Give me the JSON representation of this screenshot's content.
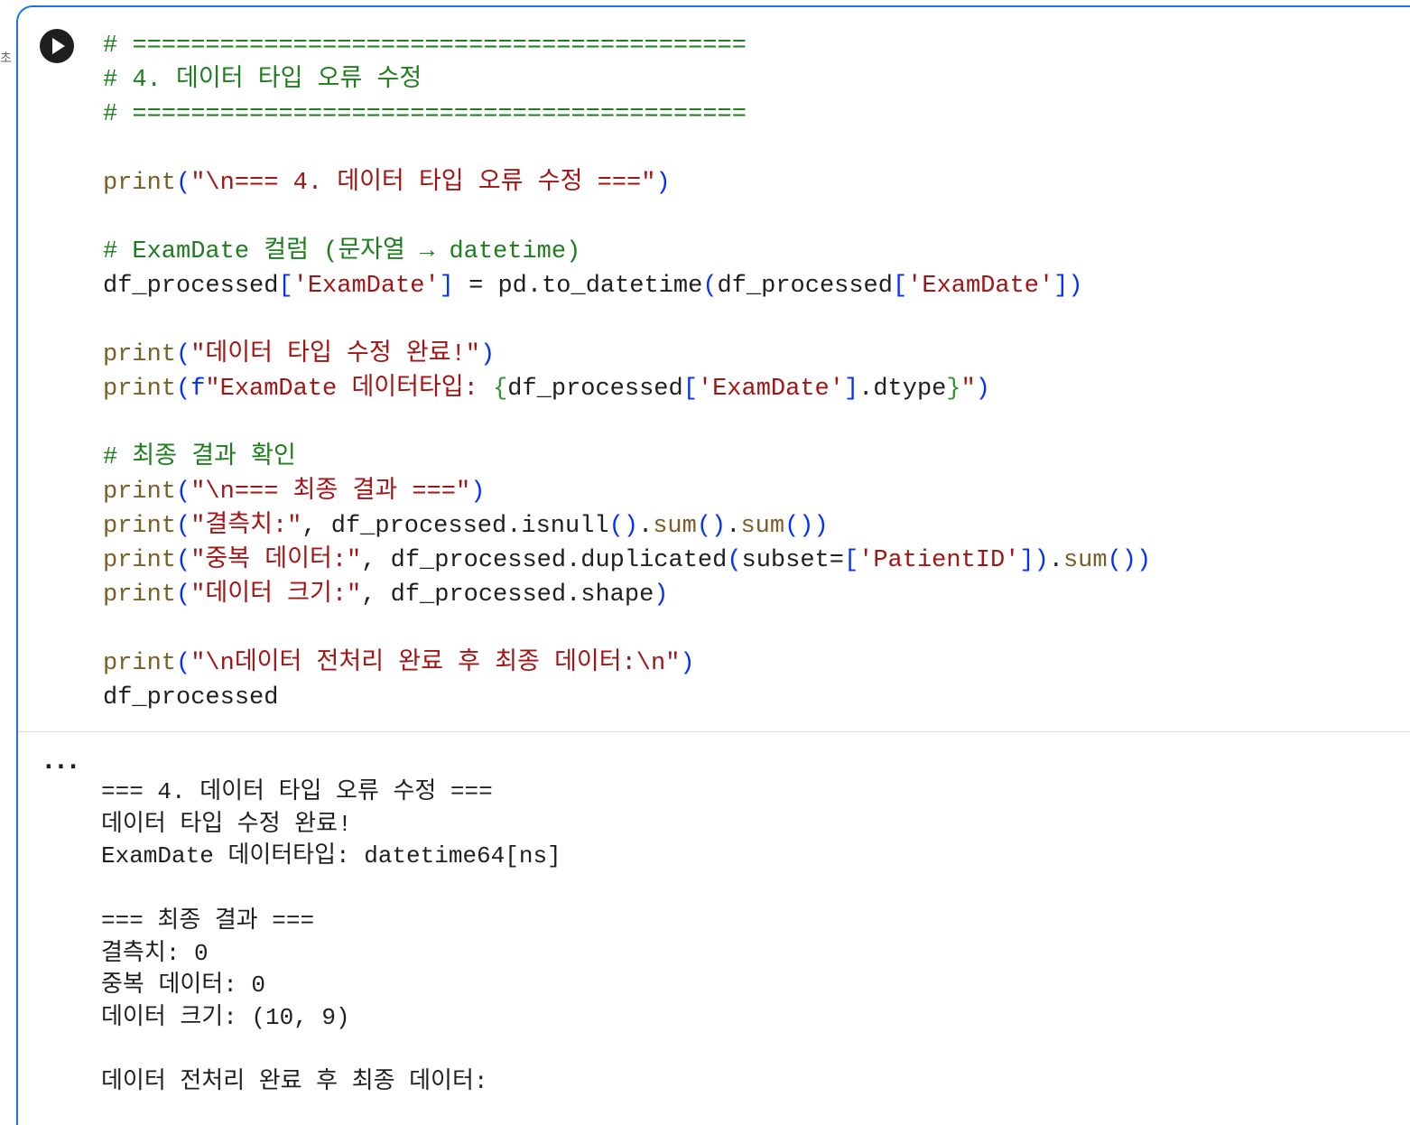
{
  "gutter_label": "초",
  "cell": {
    "run_button_label": "Run cell",
    "code_lines": [
      "# ==========================================",
      "# 4. 데이터 타입 오류 수정",
      "# ==========================================",
      "",
      "print(\"\\n=== 4. 데이터 타입 오류 수정 ===\")",
      "",
      "# ExamDate 컬럼 (문자열 → datetime)",
      "df_processed['ExamDate'] = pd.to_datetime(df_processed['ExamDate'])",
      "",
      "print(\"데이터 타입 수정 완료!\")",
      "print(f\"ExamDate 데이터타입: {df_processed['ExamDate'].dtype}\")",
      "",
      "# 최종 결과 확인",
      "print(\"\\n=== 최종 결과 ===\")",
      "print(\"결측치:\", df_processed.isnull().sum().sum())",
      "print(\"중복 데이터:\", df_processed.duplicated(subset=['PatientID']).sum())",
      "print(\"데이터 크기:\", df_processed.shape)",
      "",
      "print(\"\\n데이터 전처리 완료 후 최종 데이터:\\n\")",
      "df_processed"
    ],
    "output_menu": "...",
    "output_lines": [
      "=== 4. 데이터 타입 오류 수정 ===",
      "데이터 타입 수정 완료!",
      "ExamDate 데이터타입: datetime64[ns]",
      "",
      "=== 최종 결과 ===",
      "결측치: 0",
      "중복 데이터: 0",
      "데이터 크기: (10, 9)",
      "",
      "데이터 전처리 완료 후 최종 데이터:"
    ]
  }
}
